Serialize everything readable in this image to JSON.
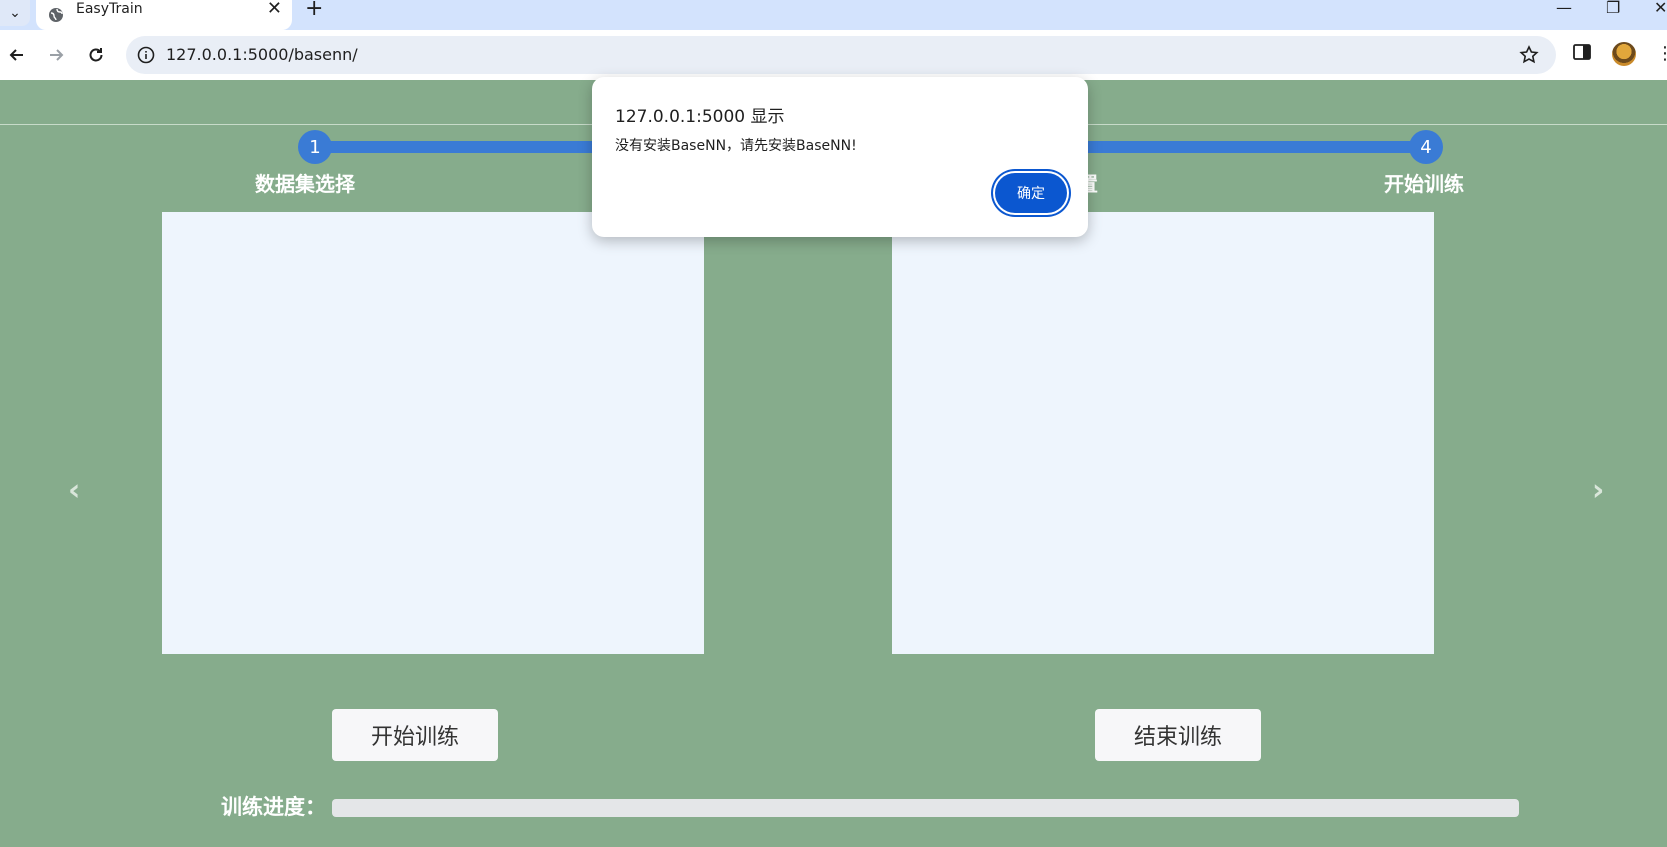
{
  "browser": {
    "tab_title": "EasyTrain",
    "url": "127.0.0.1:5000/basenn/"
  },
  "steps": [
    {
      "number": "1",
      "label": "数据集选择"
    },
    {
      "number": "4",
      "label": "开始训练"
    }
  ],
  "hidden_step_label_fragment": "置",
  "buttons": {
    "start": "开始训练",
    "stop": "结束训练"
  },
  "progress": {
    "label": "训练进度：",
    "value": 0
  },
  "dialog": {
    "title": "127.0.0.1:5000 显示",
    "message": "没有安装BaseNN，请先安装BaseNN!",
    "ok_label": "确定"
  },
  "colors": {
    "page_bg": "#86ac8c",
    "accent": "#3a7bd5",
    "panel_bg": "#eef5fd",
    "dialog_button": "#0b57d0"
  }
}
